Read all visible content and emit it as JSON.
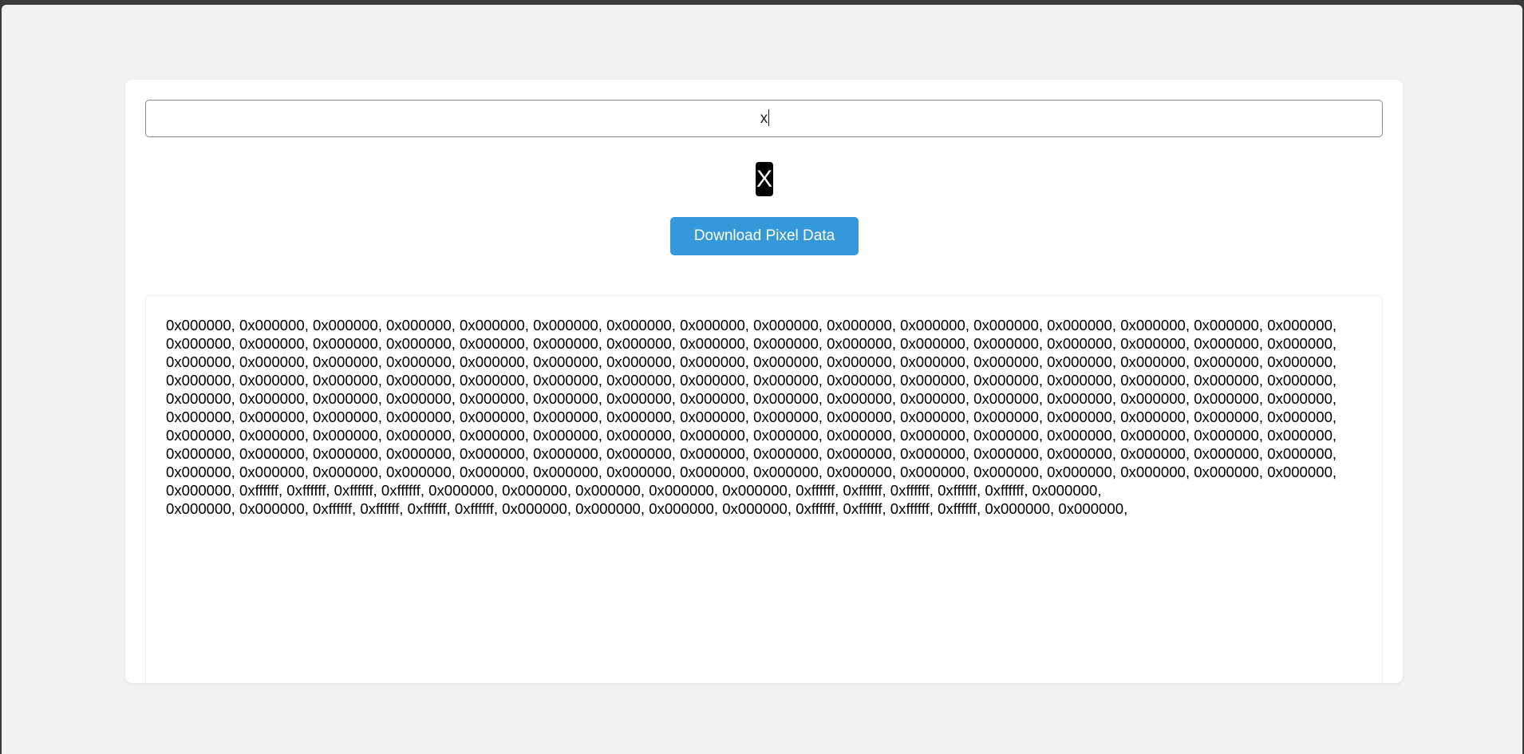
{
  "input": {
    "value": "x"
  },
  "preview": {
    "glyph": "X"
  },
  "download_button": {
    "label": "Download Pixel Data"
  },
  "pixel_rows": [
    "0x000000, 0x000000, 0x000000, 0x000000, 0x000000, 0x000000, 0x000000, 0x000000, 0x000000, 0x000000, 0x000000, 0x000000, 0x000000, 0x000000, 0x000000, 0x000000,",
    "0x000000, 0x000000, 0x000000, 0x000000, 0x000000, 0x000000, 0x000000, 0x000000, 0x000000, 0x000000, 0x000000, 0x000000, 0x000000, 0x000000, 0x000000, 0x000000,",
    "0x000000, 0x000000, 0x000000, 0x000000, 0x000000, 0x000000, 0x000000, 0x000000, 0x000000, 0x000000, 0x000000, 0x000000, 0x000000, 0x000000, 0x000000, 0x000000,",
    "0x000000, 0x000000, 0x000000, 0x000000, 0x000000, 0x000000, 0x000000, 0x000000, 0x000000, 0x000000, 0x000000, 0x000000, 0x000000, 0x000000, 0x000000, 0x000000,",
    "0x000000, 0x000000, 0x000000, 0x000000, 0x000000, 0x000000, 0x000000, 0x000000, 0x000000, 0x000000, 0x000000, 0x000000, 0x000000, 0x000000, 0x000000, 0x000000,",
    "0x000000, 0x000000, 0x000000, 0x000000, 0x000000, 0x000000, 0x000000, 0x000000, 0x000000, 0x000000, 0x000000, 0x000000, 0x000000, 0x000000, 0x000000, 0x000000,",
    "0x000000, 0x000000, 0x000000, 0x000000, 0x000000, 0x000000, 0x000000, 0x000000, 0x000000, 0x000000, 0x000000, 0x000000, 0x000000, 0x000000, 0x000000, 0x000000,",
    "0x000000, 0x000000, 0x000000, 0x000000, 0x000000, 0x000000, 0x000000, 0x000000, 0x000000, 0x000000, 0x000000, 0x000000, 0x000000, 0x000000, 0x000000, 0x000000,",
    "0x000000, 0x000000, 0x000000, 0x000000, 0x000000, 0x000000, 0x000000, 0x000000, 0x000000, 0x000000, 0x000000, 0x000000, 0x000000, 0x000000, 0x000000, 0x000000,",
    "0x000000, 0xffffff, 0xffffff, 0xffffff, 0xffffff, 0x000000, 0x000000, 0x000000, 0x000000, 0x000000, 0xffffff, 0xffffff, 0xffffff, 0xffffff, 0xffffff, 0x000000,",
    "0x000000, 0x000000, 0xffffff, 0xffffff, 0xffffff, 0xffffff, 0x000000, 0x000000, 0x000000, 0x000000, 0xffffff, 0xffffff, 0xffffff, 0xffffff, 0x000000, 0x000000,"
  ]
}
